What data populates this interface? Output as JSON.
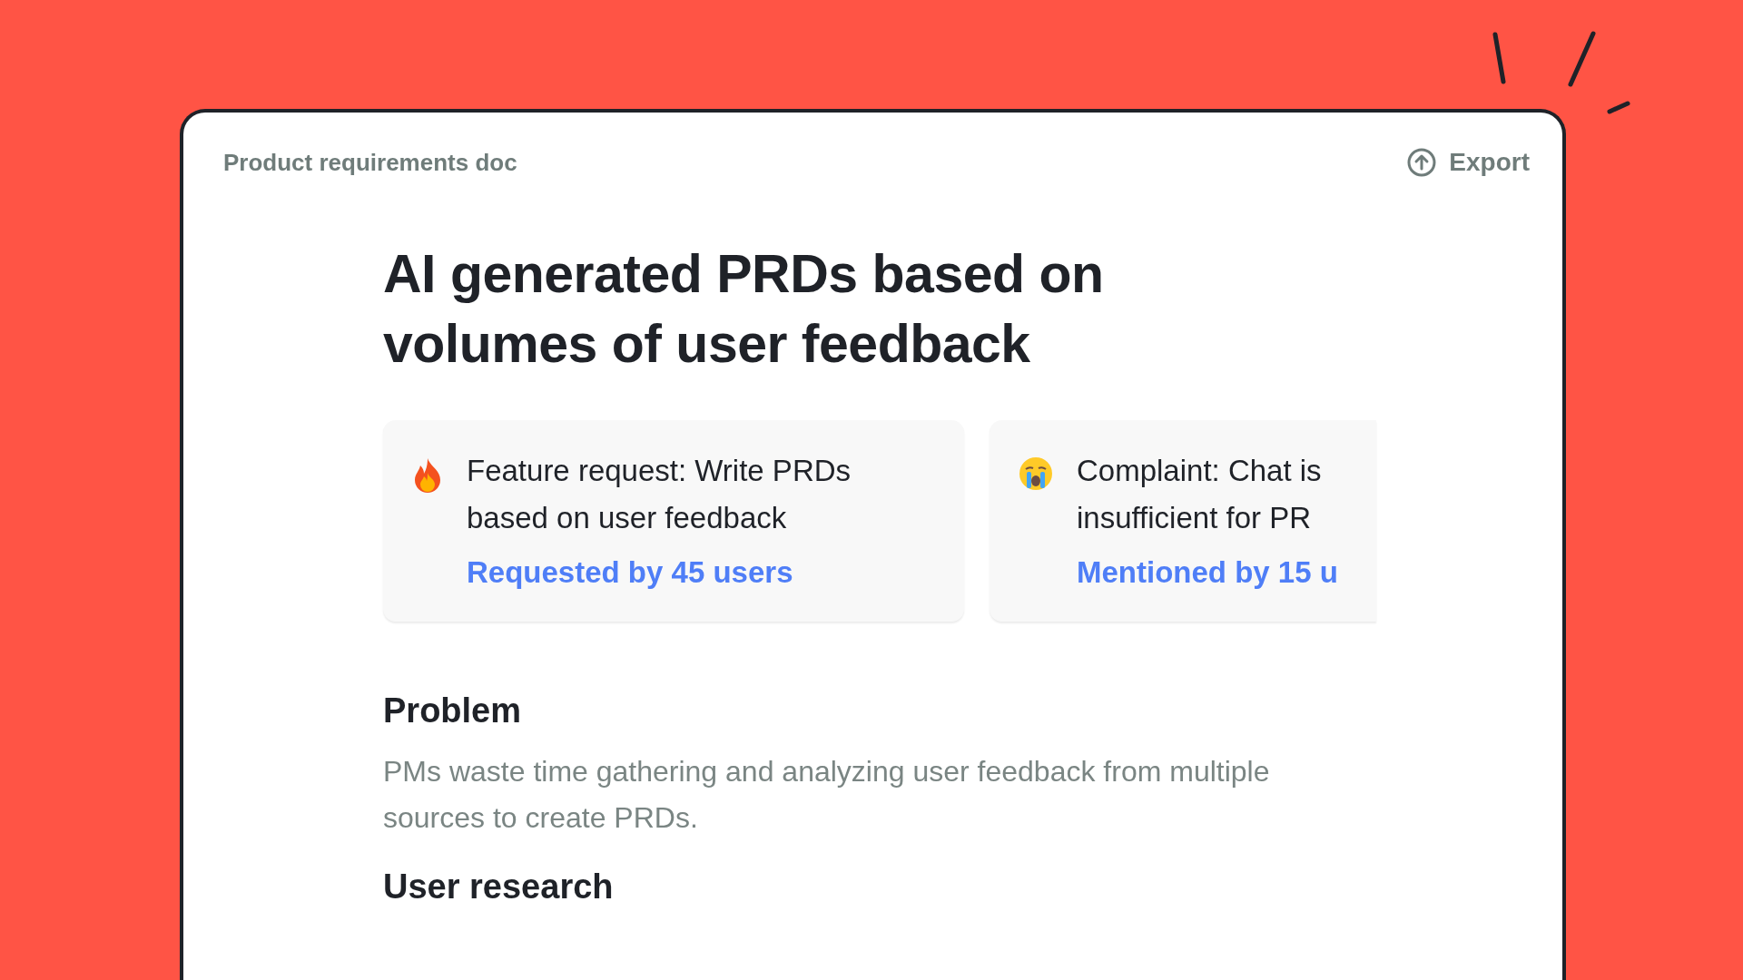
{
  "window": {
    "title": "Product requirements doc",
    "export_label": "Export"
  },
  "heading": "AI generated PRDs based on volumes of user feedback",
  "feedback_cards": [
    {
      "kind": "feature_request",
      "text": "Feature request: Write PRDs based on user feedback",
      "link": "Requested by 45 users"
    },
    {
      "kind": "complaint",
      "text": "Complaint: Chat is insufficient for PR",
      "link": "Mentioned by 15 u"
    }
  ],
  "sections": [
    {
      "title": "Problem",
      "body": "PMs waste time gathering and analyzing user feedback from multiple sources to create PRDs."
    },
    {
      "title": "User research"
    }
  ]
}
